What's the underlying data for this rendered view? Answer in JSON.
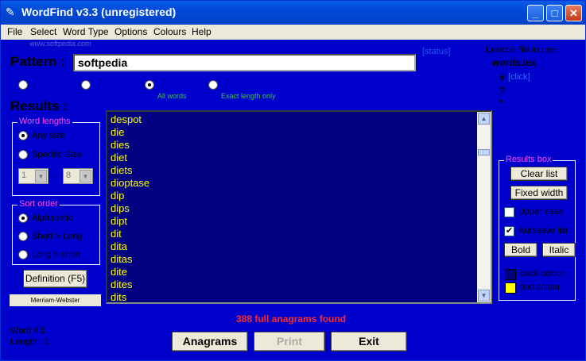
{
  "window": {
    "title": "WordFind  v3.3   (unregistered)",
    "minimize": "_",
    "maximize": "□",
    "close": "✕",
    "icon": "feather-icon"
  },
  "menu": [
    "File",
    "Select",
    "Word Type",
    "Options",
    "Colours",
    "Help"
  ],
  "watermark": "www.softpedia.com",
  "pattern": {
    "label": "Pattern :",
    "value": "softpedia",
    "status": "[status]"
  },
  "lexicon": {
    "label": "Lexicon file in use:",
    "file": "words.lex",
    "bullets": [
      "#",
      "?",
      "*"
    ],
    "link": "[click]"
  },
  "match_modes": {
    "options": [
      "",
      "",
      "All words",
      "Exact length only"
    ],
    "selected": 2
  },
  "results": {
    "label": "Results :",
    "found_text": "388 full anagrams found",
    "items": [
      "despot",
      "die",
      "dies",
      "diet",
      "diets",
      "dioptase",
      "dip",
      "dips",
      "dipt",
      "dit",
      "dita",
      "ditas",
      "dite",
      "dites",
      "dits"
    ]
  },
  "word_lengths": {
    "title": "Word lengths",
    "options": [
      "Any size",
      "Specific Size"
    ],
    "selected": 0,
    "from": "1",
    "to": "8",
    "separator": "-"
  },
  "sort_order": {
    "title": "Sort order",
    "options": [
      "Alphabetic",
      "Short > Long",
      "Long > short"
    ],
    "selected": 0
  },
  "definition_button": "Definition (F5)",
  "merriam": "Merriam-Webster",
  "word_info": {
    "word": "Word # 1",
    "length": "Length : 1"
  },
  "results_box": {
    "title": "Results box",
    "clear": "Clear list",
    "fixed": "Fixed width",
    "upper": "Upper case",
    "autosave": "Autosave list",
    "upper_checked": false,
    "autosave_checked": true,
    "bold": "Bold",
    "italic": "Italic",
    "back": "back colour",
    "text": "text colour",
    "back_color": "#000080",
    "text_color": "#ffff00"
  },
  "bottom_buttons": {
    "anagrams": "Anagrams",
    "print": "Print",
    "exit": "Exit"
  }
}
